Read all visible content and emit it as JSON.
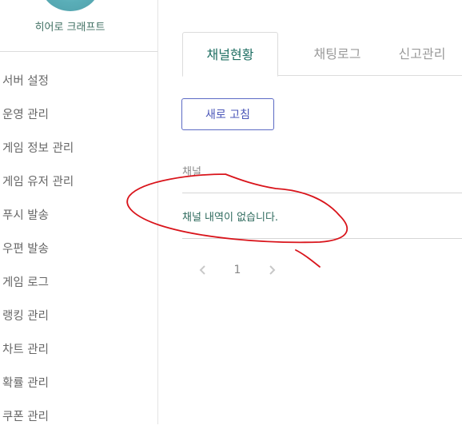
{
  "sidebar": {
    "brand": "히어로 크래프트",
    "items": [
      {
        "label": "서버 설정"
      },
      {
        "label": "운영 관리"
      },
      {
        "label": "게임 정보 관리"
      },
      {
        "label": "게임 유저 관리"
      },
      {
        "label": "푸시 발송"
      },
      {
        "label": "우편 발송"
      },
      {
        "label": "게임 로그"
      },
      {
        "label": "랭킹 관리"
      },
      {
        "label": "차트 관리"
      },
      {
        "label": "확률 관리"
      },
      {
        "label": "쿠폰 관리"
      }
    ]
  },
  "tabs": [
    {
      "label": "채널현황",
      "active": true
    },
    {
      "label": "채팅로그",
      "active": false
    },
    {
      "label": "신고관리",
      "active": false
    }
  ],
  "toolbar": {
    "refresh_label": "새로 고침"
  },
  "table": {
    "column": "채널",
    "empty_message": "채널 내역이 없습니다."
  },
  "pagination": {
    "current_page": "1",
    "prev_icon": "chevron-left-icon",
    "next_icon": "chevron-right-icon"
  },
  "colors": {
    "accent_green": "#1f6f63",
    "button_blue": "#4a56b8",
    "annotation_red": "#d9141b"
  }
}
